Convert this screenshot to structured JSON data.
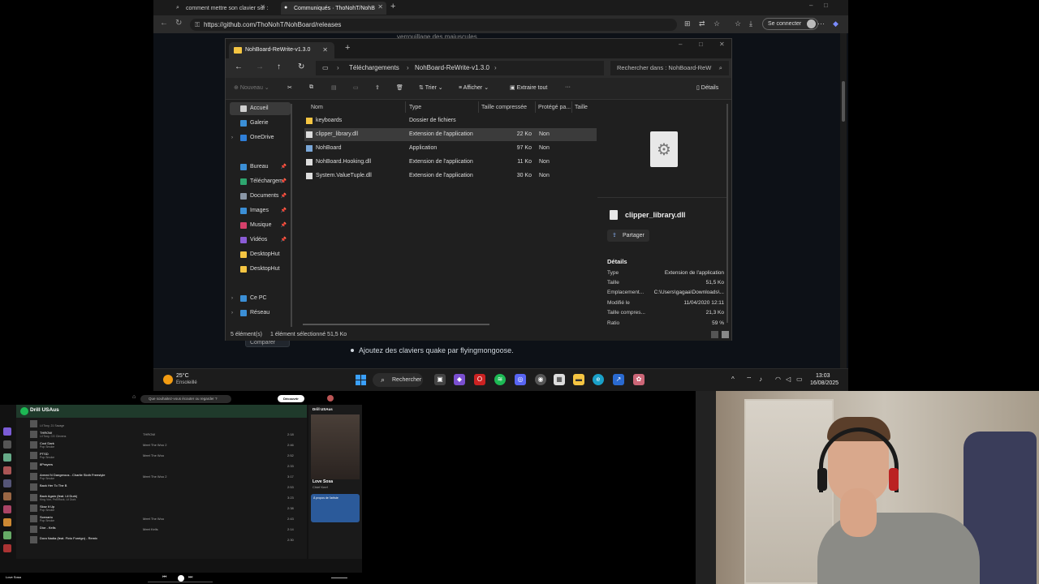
{
  "browser": {
    "tabs": [
      {
        "label": "comment mettre son clavier sur :",
        "icon": "search-icon"
      },
      {
        "label": "Communiqués · ThoNohT/NohB",
        "icon": "github-icon"
      }
    ],
    "url": "https://github.com/ThoNohT/NohBoard/releases",
    "signin": "Se connecter",
    "page_text_behind": "verrouillage des majuscules",
    "page_bullet": "Ajoutez des claviers quake par flyingmongoose.",
    "compare_button": "Comparer"
  },
  "explorer": {
    "tab_title": "NohBoard-ReWrite-v1.3.0",
    "path": [
      "Téléchargements",
      "NohBoard-ReWrite-v1.3.0"
    ],
    "search_placeholder": "Rechercher dans : NohBoard-ReW",
    "toolbar": {
      "new": "Nouveau",
      "sort": "Trier",
      "view": "Afficher",
      "extract": "Extraire tout",
      "more": "···",
      "details": "Détails"
    },
    "sidebar": [
      {
        "label": "Accueil",
        "icon": "home-icon",
        "color": "#d0d0d0"
      },
      {
        "label": "Galerie",
        "icon": "gallery-icon",
        "color": "#3b8fd6"
      },
      {
        "label": "OneDrive",
        "icon": "onedrive-icon",
        "color": "#2f7fd8"
      },
      {
        "label": "Bureau",
        "icon": "desktop-icon",
        "color": "#3b8fd6"
      },
      {
        "label": "Téléchargem",
        "icon": "download-icon",
        "color": "#2ea66f"
      },
      {
        "label": "Documents",
        "icon": "documents-icon",
        "color": "#8a97a6"
      },
      {
        "label": "Images",
        "icon": "images-icon",
        "color": "#3b8fd6"
      },
      {
        "label": "Musique",
        "icon": "music-icon",
        "color": "#d6406b"
      },
      {
        "label": "Vidéos",
        "icon": "videos-icon",
        "color": "#8b5cd6"
      },
      {
        "label": "DesktopHut",
        "icon": "folder-icon",
        "color": "#f5c542"
      },
      {
        "label": "DesktopHut",
        "icon": "folder-icon",
        "color": "#f5c542"
      },
      {
        "label": "Ce PC",
        "icon": "pc-icon",
        "color": "#3b8fd6"
      },
      {
        "label": "Réseau",
        "icon": "network-icon",
        "color": "#3b8fd6"
      }
    ],
    "columns": [
      "Nom",
      "Type",
      "Taille compressée",
      "Protégé pa...",
      "Taille"
    ],
    "files": [
      {
        "name": "keyboards",
        "type": "Dossier de fichiers",
        "size": "",
        "protected": "",
        "icon": "folder-icon"
      },
      {
        "name": "clipper_library.dll",
        "type": "Extension de l'application",
        "size": "22 Ko",
        "protected": "Non",
        "icon": "dll-icon"
      },
      {
        "name": "NohBoard",
        "type": "Application",
        "size": "97 Ko",
        "protected": "Non",
        "icon": "app-icon"
      },
      {
        "name": "NohBoard.Hooking.dll",
        "type": "Extension de l'application",
        "size": "11 Ko",
        "protected": "Non",
        "icon": "dll-icon"
      },
      {
        "name": "System.ValueTuple.dll",
        "type": "Extension de l'application",
        "size": "30 Ko",
        "protected": "Non",
        "icon": "dll-icon"
      }
    ],
    "details": {
      "filename": "clipper_library.dll",
      "share": "Partager",
      "heading": "Détails",
      "props": [
        {
          "k": "Type",
          "v": "Extension de l'application"
        },
        {
          "k": "Taille",
          "v": "51,5 Ko"
        },
        {
          "k": "Emplacement...",
          "v": "C:\\Users\\gagaa\\Downloads\\..."
        },
        {
          "k": "Modifié le",
          "v": "11/04/2020 12:11"
        },
        {
          "k": "Taille compres...",
          "v": "21,3 Ko"
        },
        {
          "k": "Ratio",
          "v": "59 %"
        }
      ]
    },
    "status": {
      "count": "5 élément(s)",
      "selected": "1 élément sélectionné  51,5 Ko"
    }
  },
  "taskbar": {
    "temp": "25°C",
    "weather": "Ensoleillé",
    "search": "Rechercher",
    "time": "13:03",
    "date": "16/08/2025"
  },
  "spotify": {
    "search_placeholder": "Que souhaitez-vous écouter ou regarder ?",
    "premium": "Découvrir Premium",
    "playlist_title": "Drill USAus",
    "tracks": [
      {
        "n": "",
        "title": "",
        "artist": "Lil Tony, 21 Savage",
        "album": "",
        "date": "",
        "dur": ""
      },
      {
        "n": "",
        "title": "THROW",
        "artist": "Lil Tony, CG Clevens",
        "album": "THROW",
        "date": "",
        "dur": "2:18"
      },
      {
        "n": "",
        "title": "Cool Dark",
        "artist": "Pop Smoke",
        "album": "Meet The Woo 2",
        "date": "",
        "dur": "2:46"
      },
      {
        "n": "",
        "title": "PTSD",
        "artist": "Pop Smoke",
        "album": "Meet The Woo",
        "date": "",
        "dur": "2:52"
      },
      {
        "n": "",
        "title": "8Prayers",
        "artist": "",
        "album": "",
        "date": "",
        "dur": "2:33"
      },
      {
        "n": "",
        "title": "Armed N Dangerous - Charlie Sloth Freestyle",
        "artist": "Pop Smoke",
        "album": "Meet The Woo 2",
        "date": "",
        "dur": "3:17"
      },
      {
        "n": "",
        "title": "Back Her To The B",
        "artist": "",
        "album": "",
        "date": "",
        "dur": "2:53"
      },
      {
        "n": "",
        "title": "Back Again (feat. Lil Durk)",
        "artist": "King Von, PnBRock, Lil Durk",
        "album": "",
        "date": "",
        "dur": "3:23"
      },
      {
        "n": "",
        "title": "Slow It Up",
        "artist": "Pop Smoke",
        "album": "",
        "date": "",
        "dur": "2:38"
      },
      {
        "n": "",
        "title": "Scenario",
        "artist": "Pop Smoke",
        "album": "Meet The Woo",
        "date": "",
        "dur": "2:43"
      },
      {
        "n": "",
        "title": "Dior - Kells",
        "artist": "",
        "album": "Meet Kells",
        "date": "",
        "dur": "2:14"
      },
      {
        "n": "",
        "title": "Dora Nadia (feat. Fivio Foreign) - Remix",
        "artist": "",
        "album": "",
        "date": "",
        "dur": "2:30"
      }
    ],
    "now_playing": {
      "title": "Love Sosa",
      "artist": "Chief Keef"
    },
    "side_title": "Drill USAus",
    "about": "À propos de l'artiste"
  },
  "colors": {
    "browser_bg": "#202124",
    "explorer_bg": "#1f1f1f",
    "spotify_green": "#1db954",
    "github_bg": "#0d1117"
  }
}
